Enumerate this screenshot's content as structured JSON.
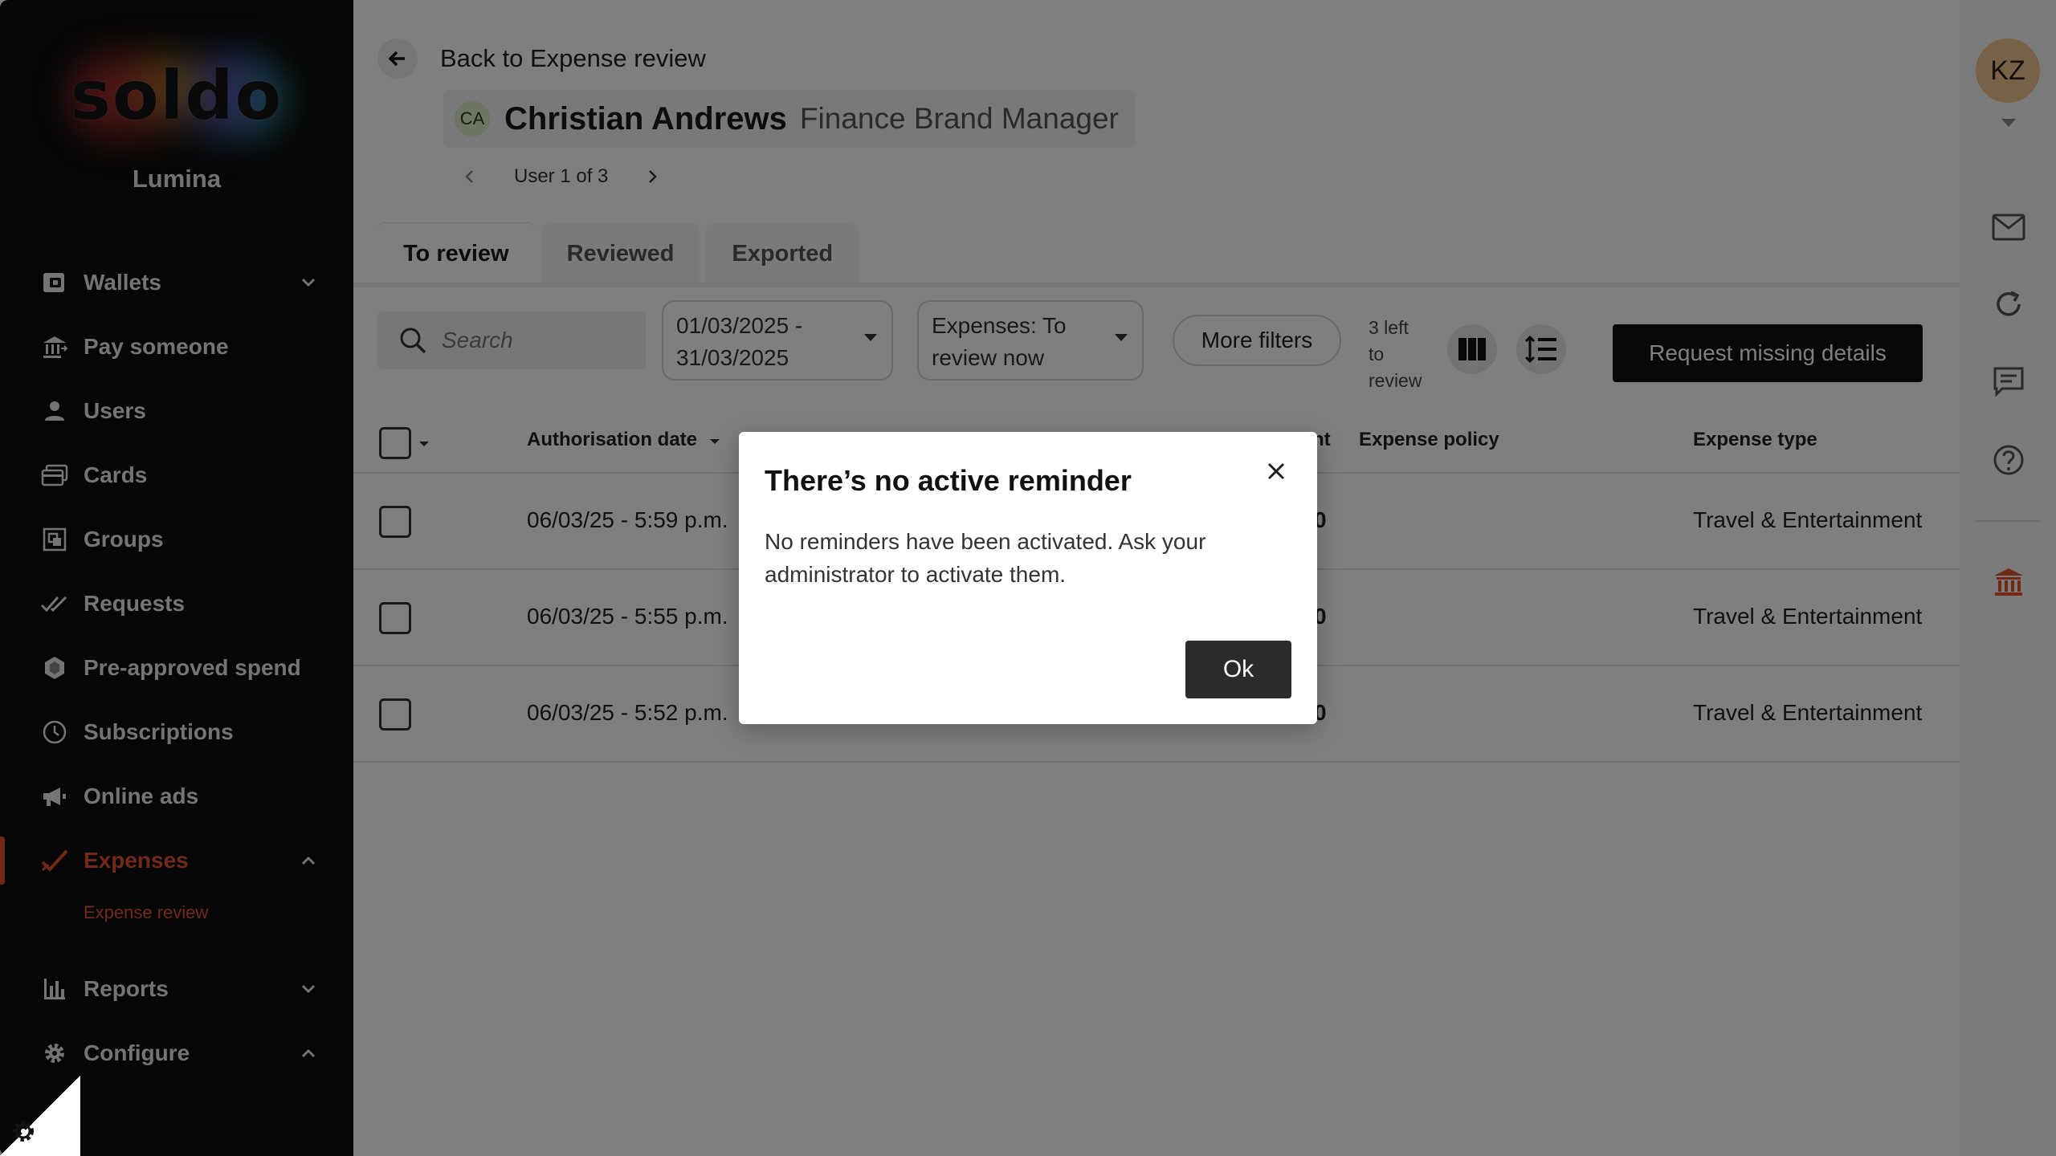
{
  "sidebar": {
    "logo": "soldo",
    "org": "Lumina",
    "items": [
      {
        "label": "Wallets"
      },
      {
        "label": "Pay someone"
      },
      {
        "label": "Users"
      },
      {
        "label": "Cards"
      },
      {
        "label": "Groups"
      },
      {
        "label": "Requests"
      },
      {
        "label": "Pre-approved spend"
      },
      {
        "label": "Subscriptions"
      },
      {
        "label": "Online ads"
      },
      {
        "label": "Expenses"
      },
      {
        "label": "Reports"
      },
      {
        "label": "Configure"
      }
    ],
    "sub_items": [
      {
        "label": "Expense review"
      }
    ],
    "accent": "#e5522d"
  },
  "header": {
    "back_label": "Back to Expense review",
    "user_initials": "CA",
    "user_name": "Christian Andrews",
    "user_role": "Finance Brand Manager",
    "pager_text": "User 1 of 3"
  },
  "tabs": [
    {
      "label": "To review"
    },
    {
      "label": "Reviewed"
    },
    {
      "label": "Exported"
    }
  ],
  "toolbar": {
    "search_placeholder": "Search",
    "date_line1": "01/03/2025 -",
    "date_line2": "31/03/2025",
    "status_line1": "Expenses: To",
    "status_line2": "review now",
    "more_filters": "More filters",
    "left_count_1": "3 left",
    "left_count_2": "to",
    "left_count_3": "review",
    "request_button": "Request missing details"
  },
  "table": {
    "columns": {
      "auth_date": "Authorisation date",
      "amount_partial": "nt",
      "policy": "Expense policy",
      "type": "Expense type"
    },
    "rows": [
      {
        "date": "06/03/25 - 5:59 p.m.",
        "amount_partial": "0",
        "type": "Travel & Entertainment"
      },
      {
        "date": "06/03/25 - 5:55 p.m.",
        "amount_partial": "0",
        "type": "Travel & Entertainment"
      },
      {
        "date": "06/03/25 - 5:52 p.m.",
        "amount_partial": "0",
        "type": "Travel & Entertainment"
      }
    ]
  },
  "rail": {
    "avatar_initials": "KZ",
    "icons": [
      "mail-icon",
      "refresh-icon",
      "chat-icon",
      "help-icon",
      "bank-icon"
    ]
  },
  "modal": {
    "title": "There’s no active reminder",
    "body": "No reminders have been activated. Ask your administrator to activate them.",
    "ok": "Ok"
  }
}
